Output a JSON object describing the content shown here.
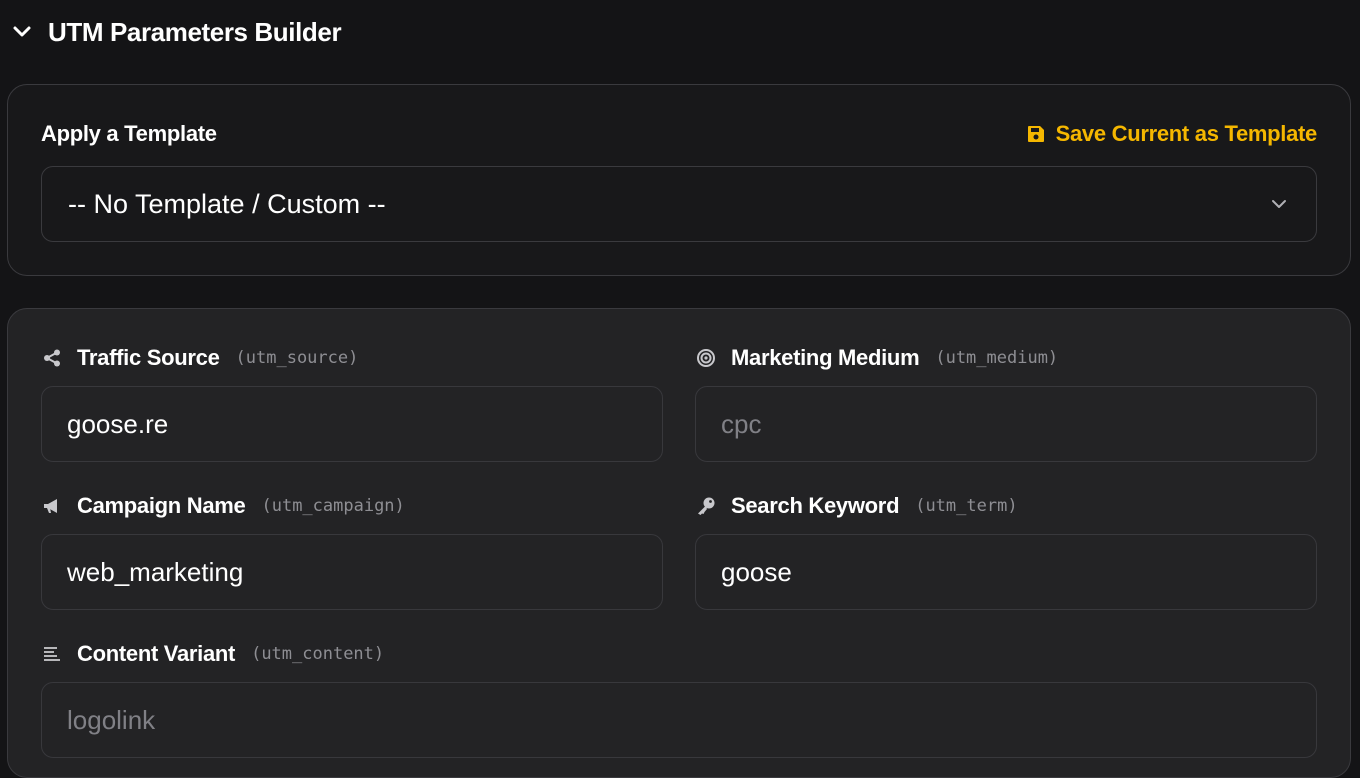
{
  "section": {
    "title": "UTM Parameters Builder",
    "toggle_icon": "chevron-down-icon"
  },
  "template": {
    "label": "Apply a Template",
    "save_label": "Save Current as Template",
    "save_icon": "floppy-disk-icon",
    "selected": "-- No Template / Custom --",
    "dropdown_icon": "chevron-down-icon"
  },
  "fields": {
    "source": {
      "label": "Traffic Source",
      "param": "(utm_source)",
      "value": "goose.re",
      "icon": "share-icon"
    },
    "medium": {
      "label": "Marketing Medium",
      "param": "(utm_medium)",
      "placeholder": "cpc",
      "icon": "target-icon"
    },
    "campaign": {
      "label": "Campaign Name",
      "param": "(utm_campaign)",
      "value": "web_marketing",
      "icon": "megaphone-icon"
    },
    "term": {
      "label": "Search Keyword",
      "param": "(utm_term)",
      "value": "goose",
      "icon": "key-icon"
    },
    "content": {
      "label": "Content Variant",
      "param": "(utm_content)",
      "placeholder": "logolink",
      "icon": "align-left-icon"
    }
  },
  "colors": {
    "background": "#141416",
    "panel": "#232325",
    "accent": "#f5b700",
    "muted": "#8e8e93"
  }
}
